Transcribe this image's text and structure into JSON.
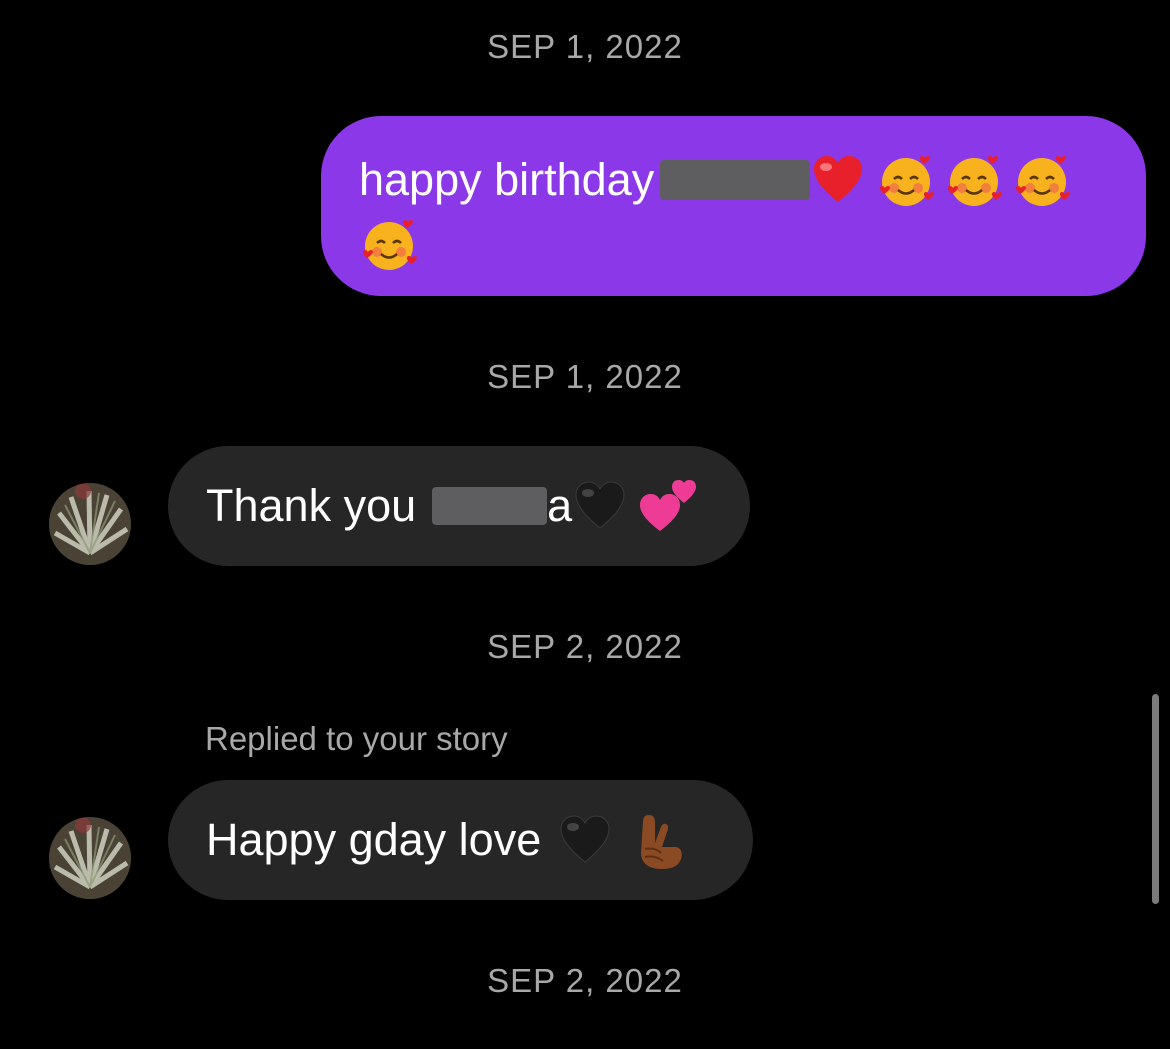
{
  "timestamps": [
    "SEP 1, 2022",
    "SEP 1, 2022",
    "SEP 2, 2022",
    "SEP 2, 2022"
  ],
  "messages": [
    {
      "direction": "outgoing",
      "text": "happy birthday",
      "emojis": [
        "red-heart",
        "smiling-face-with-hearts",
        "smiling-face-with-hearts",
        "smiling-face-with-hearts",
        "smiling-face-with-hearts"
      ]
    },
    {
      "direction": "incoming",
      "text": "Thank you",
      "trailing_visible_char": "a",
      "emojis": [
        "black-heart",
        "two-hearts"
      ]
    },
    {
      "direction": "incoming",
      "reply_note": "Replied to your story",
      "text": "Happy gday love",
      "emojis": [
        "black-heart",
        "crossed-fingers"
      ]
    }
  ],
  "colors": {
    "background": "#000000",
    "outgoing_bubble": "#8b38e8",
    "incoming_bubble": "#262626",
    "timestamp_text": "#a8a8a8",
    "redaction": "#5e5e60"
  }
}
